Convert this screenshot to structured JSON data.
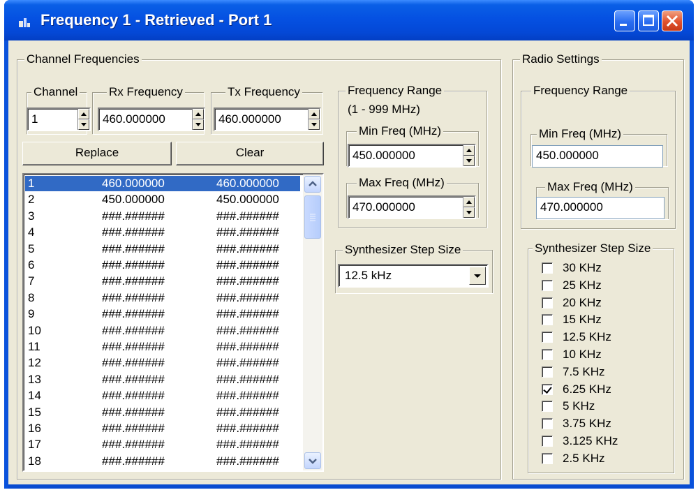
{
  "window": {
    "title": "Frequency 1 - Retrieved - Port 1",
    "controls": [
      "minimize",
      "maximize",
      "close"
    ]
  },
  "channel_frequencies": {
    "group_label": "Channel Frequencies",
    "channel": {
      "label": "Channel",
      "value": "1"
    },
    "rx": {
      "label": "Rx Frequency",
      "value": "460.000000"
    },
    "tx": {
      "label": "Tx Frequency",
      "value": "460.000000"
    },
    "replace_label": "Replace",
    "clear_label": "Clear",
    "list": [
      [
        "1",
        "460.000000",
        "460.000000"
      ],
      [
        "2",
        "450.000000",
        "450.000000"
      ],
      [
        "3",
        "###.######",
        "###.######"
      ],
      [
        "4",
        "###.######",
        "###.######"
      ],
      [
        "5",
        "###.######",
        "###.######"
      ],
      [
        "6",
        "###.######",
        "###.######"
      ],
      [
        "7",
        "###.######",
        "###.######"
      ],
      [
        "8",
        "###.######",
        "###.######"
      ],
      [
        "9",
        "###.######",
        "###.######"
      ],
      [
        "10",
        "###.######",
        "###.######"
      ],
      [
        "11",
        "###.######",
        "###.######"
      ],
      [
        "12",
        "###.######",
        "###.######"
      ],
      [
        "13",
        "###.######",
        "###.######"
      ],
      [
        "14",
        "###.######",
        "###.######"
      ],
      [
        "15",
        "###.######",
        "###.######"
      ],
      [
        "16",
        "###.######",
        "###.######"
      ],
      [
        "17",
        "###.######",
        "###.######"
      ],
      [
        "18",
        "###.######",
        "###.######"
      ]
    ],
    "selected_index": 0
  },
  "frequency_range": {
    "group_label": "Frequency Range",
    "range_note": "(1 - 999 MHz)",
    "min": {
      "label": "Min Freq (MHz)",
      "value": "450.000000"
    },
    "max": {
      "label": "Max Freq (MHz)",
      "value": "470.000000"
    }
  },
  "step_size": {
    "group_label": "Synthesizer Step Size",
    "selected": "12.5 kHz"
  },
  "radio_settings": {
    "group_label": "Radio Settings",
    "freq_range": {
      "group_label": "Frequency Range",
      "min": {
        "label": "Min Freq (MHz)",
        "value": "450.000000"
      },
      "max": {
        "label": "Max Freq (MHz)",
        "value": "470.000000"
      }
    },
    "step_size": {
      "group_label": "Synthesizer Step Size",
      "options": [
        {
          "label": "30 KHz",
          "checked": false
        },
        {
          "label": "25 KHz",
          "checked": false
        },
        {
          "label": "20 KHz",
          "checked": false
        },
        {
          "label": "15 KHz",
          "checked": false
        },
        {
          "label": "12.5 KHz",
          "checked": false
        },
        {
          "label": "10 KHz",
          "checked": false
        },
        {
          "label": "7.5 KHz",
          "checked": false
        },
        {
          "label": "6.25 KHz",
          "checked": true
        },
        {
          "label": "5 KHz",
          "checked": false
        },
        {
          "label": "3.75 KHz",
          "checked": false
        },
        {
          "label": "3.125 KHz",
          "checked": false
        },
        {
          "label": "2.5 KHz",
          "checked": false
        }
      ]
    }
  }
}
